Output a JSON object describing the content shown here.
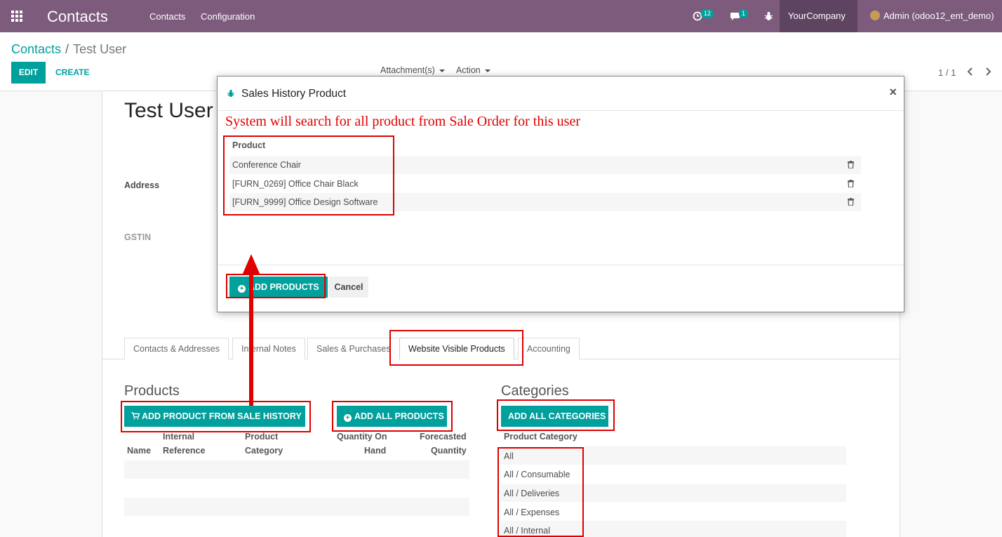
{
  "navbar": {
    "brand": "Contacts",
    "menu": [
      "Contacts",
      "Configuration"
    ],
    "activity_badge": "12",
    "messages_badge": "1",
    "company": "YourCompany",
    "user": "Admin (odoo12_ent_demo)"
  },
  "breadcrumb": {
    "parent": "Contacts",
    "separator": "/",
    "current": "Test User"
  },
  "control_panel": {
    "edit_label": "EDIT",
    "create_label": "CREATE",
    "attachments_label": "Attachment(s)",
    "action_label": "Action",
    "pager": "1 / 1"
  },
  "form": {
    "record_name": "Test User",
    "address_label": "Address",
    "gstin_label": "GSTIN",
    "tabs": [
      "Contacts & Addresses",
      "Internal Notes",
      "Sales & Purchases",
      "Website Visible Products",
      "Accounting"
    ],
    "active_tab": "Website Visible Products",
    "products": {
      "title": "Products",
      "add_from_history_label": "ADD PRODUCT FROM SALE HISTORY",
      "add_all_label": "ADD ALL PRODUCTS",
      "columns": {
        "name": "Name",
        "internal_ref_1": "Internal",
        "internal_ref_2": "Reference",
        "category_1": "Product",
        "category_2": "Category",
        "qty_1": "Quantity On",
        "qty_2": "Hand",
        "forecast_1": "Forecasted",
        "forecast_2": "Quantity"
      }
    },
    "categories": {
      "title": "Categories",
      "add_all_label": "ADD ALL CATEGORIES",
      "column": "Product Category",
      "rows": [
        "All",
        "All / Consumable",
        "All / Deliveries",
        "All / Expenses",
        "All / Internal"
      ]
    }
  },
  "modal": {
    "title": "Sales History Product",
    "close_glyph": "×",
    "note": "System will search for all product from Sale Order for this user",
    "column": "Product",
    "rows": [
      "Conference Chair",
      "[FURN_0269] Office Chair Black",
      "[FURN_9999] Office Design Software"
    ],
    "add_products_label": "ADD PRODUCTS",
    "cancel_label": "Cancel"
  },
  "colors": {
    "navbar": "#7c5b7c",
    "accent": "#00a09d",
    "annotation": "#e00000"
  },
  "icons": [
    "apps-grid-icon",
    "activity-clock-icon",
    "chat-icon",
    "bug-icon",
    "caret-down-icon",
    "avatar",
    "chevron-left-icon",
    "chevron-right-icon",
    "trash-icon",
    "cart-icon",
    "plus-circle-icon",
    "close-icon"
  ]
}
